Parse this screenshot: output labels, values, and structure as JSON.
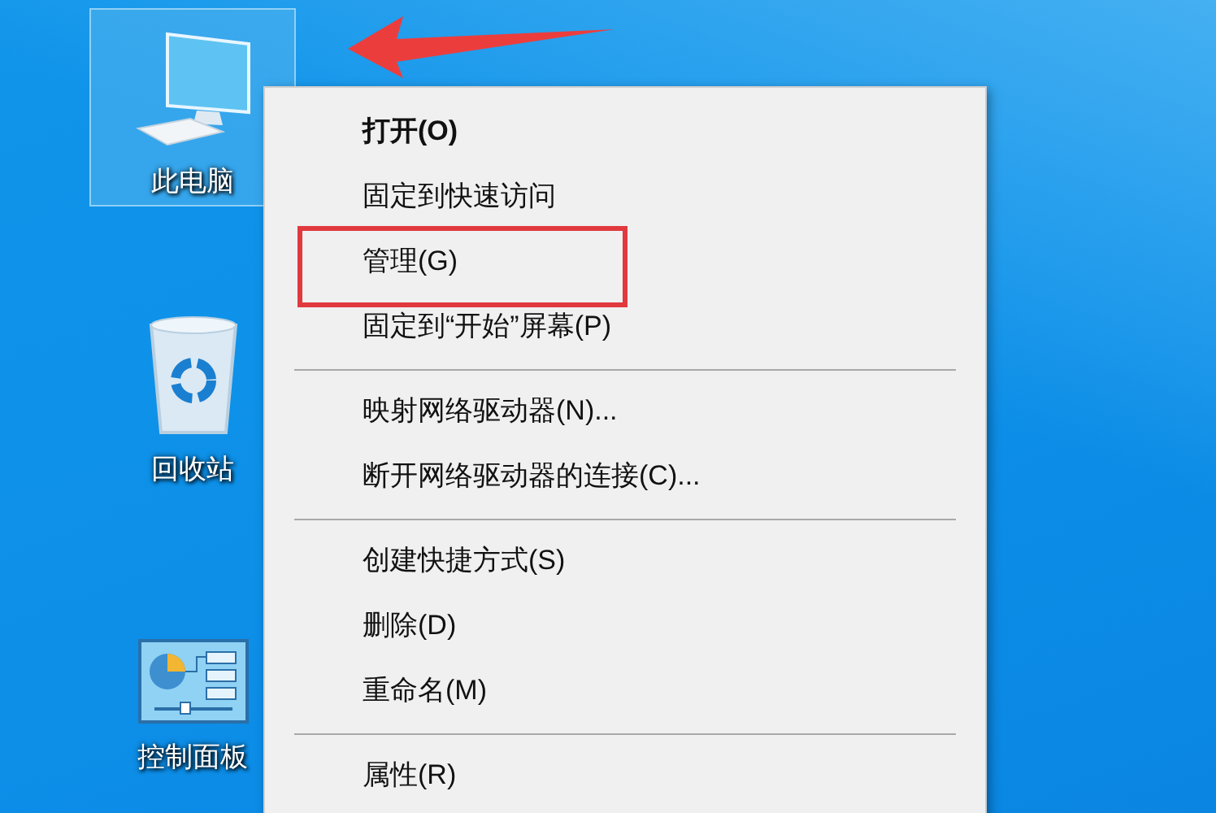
{
  "desktop_icons": [
    {
      "kind": "computer",
      "label": "此电脑",
      "selected": true
    },
    {
      "kind": "recycle_bin",
      "label": "回收站",
      "selected": false
    },
    {
      "kind": "control_panel",
      "label": "控制面板",
      "selected": false
    }
  ],
  "context_menu": {
    "items": [
      {
        "kind": "item",
        "label": "打开(O)",
        "default": true,
        "highlighted": false
      },
      {
        "kind": "item",
        "label": "固定到快速访问",
        "default": false,
        "highlighted": false
      },
      {
        "kind": "item",
        "label": "管理(G)",
        "default": false,
        "highlighted": true
      },
      {
        "kind": "item",
        "label": "固定到“开始”屏幕(P)",
        "default": false,
        "highlighted": false
      },
      {
        "kind": "separator"
      },
      {
        "kind": "item",
        "label": "映射网络驱动器(N)...",
        "default": false,
        "highlighted": false
      },
      {
        "kind": "item",
        "label": "断开网络驱动器的连接(C)...",
        "default": false,
        "highlighted": false
      },
      {
        "kind": "separator"
      },
      {
        "kind": "item",
        "label": "创建快捷方式(S)",
        "default": false,
        "highlighted": false
      },
      {
        "kind": "item",
        "label": "删除(D)",
        "default": false,
        "highlighted": false
      },
      {
        "kind": "item",
        "label": "重命名(M)",
        "default": false,
        "highlighted": false
      },
      {
        "kind": "separator"
      },
      {
        "kind": "item",
        "label": "属性(R)",
        "default": false,
        "highlighted": false
      }
    ]
  }
}
